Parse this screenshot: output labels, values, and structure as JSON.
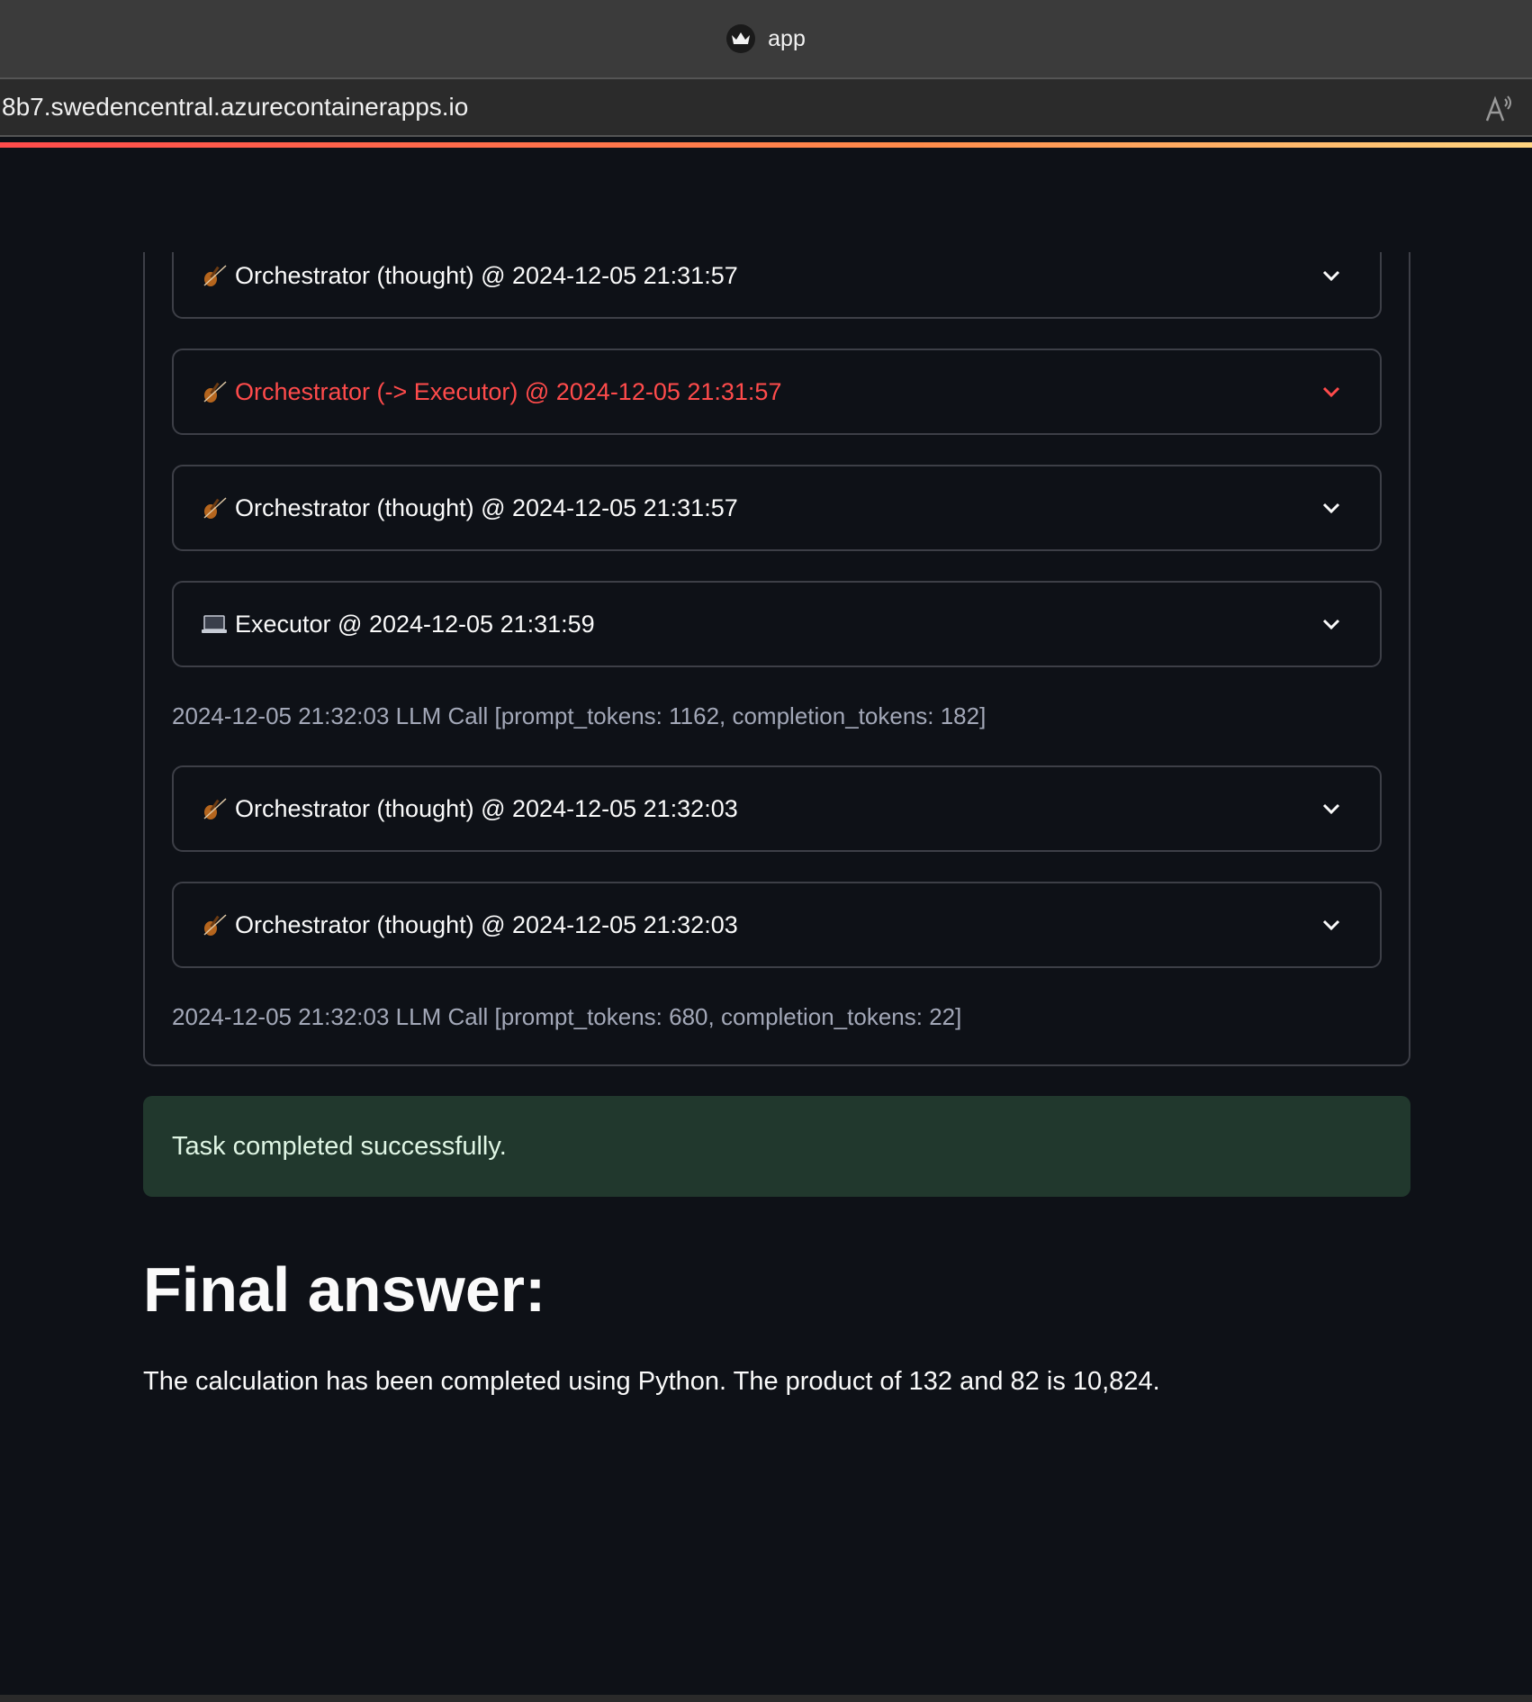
{
  "browser": {
    "tab_title": "app",
    "url": "8b7.swedencentral.azurecontainerapps.io"
  },
  "log": {
    "items": [
      {
        "kind": "expander",
        "icon": "violin-icon",
        "label": "Orchestrator (thought) @ 2024-12-05 21:31:57"
      },
      {
        "kind": "expander",
        "icon": "violin-icon",
        "label": "Orchestrator (-> Executor) @ 2024-12-05 21:31:57",
        "color": "#ff4b4b"
      },
      {
        "kind": "expander",
        "icon": "violin-icon",
        "label": "Orchestrator (thought) @ 2024-12-05 21:31:57"
      },
      {
        "kind": "expander",
        "icon": "laptop-icon",
        "label": "Executor @ 2024-12-05 21:31:59"
      },
      {
        "kind": "text",
        "label": "2024-12-05 21:32:03 LLM Call [prompt_tokens: 1162, completion_tokens: 182]"
      },
      {
        "kind": "expander",
        "icon": "violin-icon",
        "label": "Orchestrator (thought) @ 2024-12-05 21:32:03"
      },
      {
        "kind": "expander",
        "icon": "violin-icon",
        "label": "Orchestrator (thought) @ 2024-12-05 21:32:03"
      },
      {
        "kind": "text",
        "label": "2024-12-05 21:32:03 LLM Call [prompt_tokens: 680, completion_tokens: 22]"
      }
    ]
  },
  "status": {
    "message": "Task completed successfully.",
    "color": "#21382d"
  },
  "final": {
    "heading": "Final answer:",
    "text": "The calculation has been completed using Python. The product of 132 and 82 is 10,824."
  },
  "colors": {
    "background": "#0e1117",
    "accent": "#ff4b4b"
  }
}
